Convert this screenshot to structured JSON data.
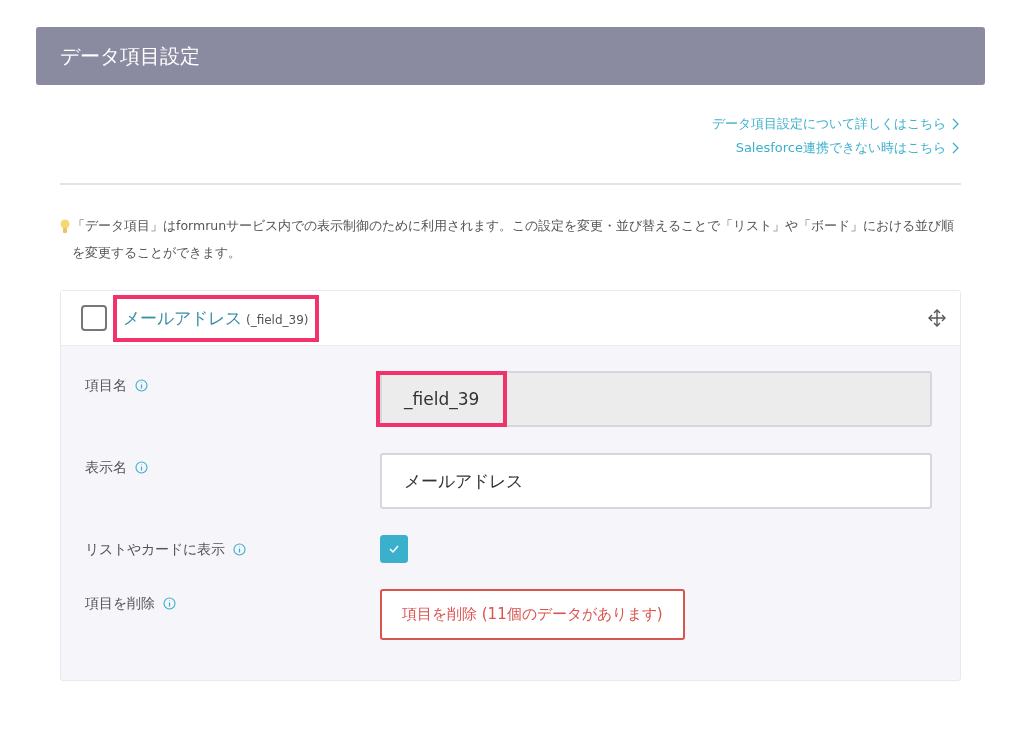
{
  "header": {
    "title": "データ項目設定"
  },
  "links": [
    {
      "label": "データ項目設定について詳しくはこちら"
    },
    {
      "label": "Salesforce連携できない時はこちら"
    }
  ],
  "notice": "「データ項目」はformrunサービス内での表示制御のために利用されます。この設定を変更・並び替えることで「リスト」や「ボード」における並び順を変更することができます。",
  "item": {
    "checked": false,
    "name": "メールアドレス",
    "field_id": "(_field_39)",
    "highlighted": true,
    "rows": [
      {
        "kind": "readonly",
        "label": "項目名",
        "value": "_field_39",
        "highlighted": true
      },
      {
        "kind": "text",
        "label": "表示名",
        "value": "メールアドレス",
        "highlighted": false
      },
      {
        "kind": "checkbox",
        "label": "リストやカードに表示",
        "checked": true
      },
      {
        "kind": "delete",
        "label": "項目を削除",
        "button": "項目を削除 (11個のデータがあります)"
      }
    ]
  }
}
